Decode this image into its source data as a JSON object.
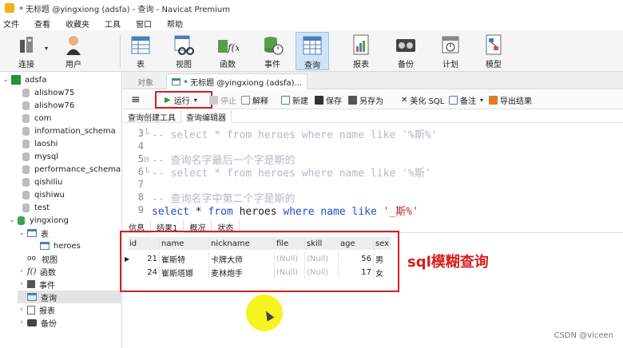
{
  "window": {
    "title": "* 无标题 @yingxiong (adsfa) - 查询 - Navicat Premium"
  },
  "menu": [
    "文件",
    "查看",
    "收藏夹",
    "工具",
    "窗口",
    "帮助"
  ],
  "ribbon": [
    {
      "label": "连接",
      "icon": "connection-icon"
    },
    {
      "label": "用户",
      "icon": "user-icon"
    },
    {
      "label": "表",
      "icon": "table-icon"
    },
    {
      "label": "视图",
      "icon": "view-icon"
    },
    {
      "label": "函数",
      "icon": "function-icon"
    },
    {
      "label": "事件",
      "icon": "event-icon"
    },
    {
      "label": "查询",
      "icon": "query-icon"
    },
    {
      "label": "报表",
      "icon": "report-icon"
    },
    {
      "label": "备份",
      "icon": "backup-icon"
    },
    {
      "label": "计划",
      "icon": "schedule-icon"
    },
    {
      "label": "模型",
      "icon": "model-icon"
    }
  ],
  "sidebar": {
    "connection": "adsfa",
    "databases": [
      "alishow75",
      "alishow76",
      "com",
      "information_schema",
      "laoshi",
      "mysql",
      "performance_schema",
      "qishiliu",
      "qishiwu",
      "test"
    ],
    "open_db": "yingxiong",
    "children": {
      "tables": "表",
      "table_heroes": "heroes",
      "views": "视图",
      "functions": "函数",
      "events": "事件",
      "queries": "查询",
      "reports": "报表",
      "backups": "备份"
    }
  },
  "tabs": {
    "objects": "对象",
    "query": "* 无标题 @yingxiong (adsfa)..."
  },
  "toolbar": {
    "menu_icon": "≡",
    "run": "运行",
    "stop": "停止",
    "explain": "解释",
    "new": "新建",
    "save": "保存",
    "save_as": "另存为",
    "beautify": "美化 SQL",
    "note": "备注",
    "export": "导出结果"
  },
  "subtabs": {
    "builder": "查询创建工具",
    "editor": "查询编辑器"
  },
  "editor_lines": [
    {
      "n": "3",
      "gutter": "└",
      "faded": "-- select * from heroes where name like '%斯%'"
    },
    {
      "n": "4",
      "gutter": "",
      "faded": ""
    },
    {
      "n": "5",
      "gutter": "⊟",
      "faded": "-- 查询名字最后一个字是斯的"
    },
    {
      "n": "6",
      "gutter": "└",
      "faded": "-- select * from heroes where name like '%斯'"
    },
    {
      "n": "7",
      "gutter": "",
      "faded": ""
    },
    {
      "n": "8",
      "gutter": "",
      "faded": "-- 查询名字中第二个字是斯的"
    }
  ],
  "active_line": {
    "n": "9",
    "kw1": "select",
    "p1": " * ",
    "kw2": "from",
    "p2": " heroes ",
    "kw3": "where",
    "p3": " ",
    "kw4": "name",
    "p4": " ",
    "kw5": "like",
    "p5": " ",
    "str": "'_斯%'"
  },
  "result_tabs": [
    "信息",
    "结果1",
    "概况",
    "状态"
  ],
  "result": {
    "columns": [
      "id",
      "name",
      "nickname",
      "file",
      "skill",
      "age",
      "sex"
    ],
    "rows": [
      [
        "21",
        "崔斯特",
        "卡牌大师",
        "(Null)",
        "(Null)",
        "56",
        "男"
      ],
      [
        "24",
        "崔斯塔娜",
        "麦林炮手",
        "(Null)",
        "(Null)",
        "17",
        "女"
      ]
    ]
  },
  "annotation": "sql模糊查询",
  "watermark": "CSDN @viceen"
}
